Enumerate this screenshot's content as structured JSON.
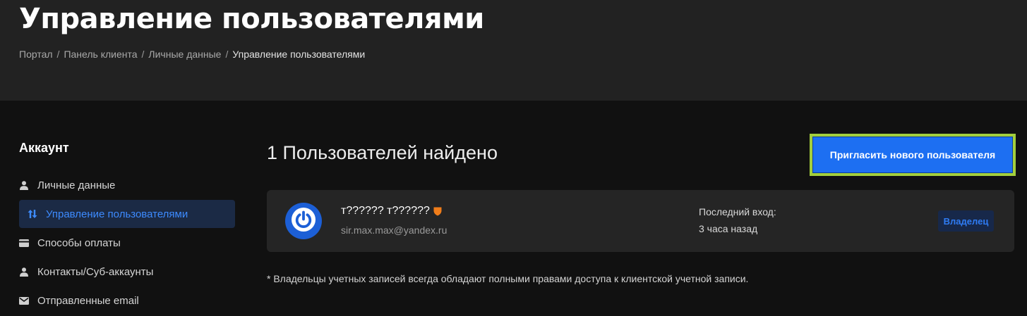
{
  "header": {
    "title": "Управление пользователями",
    "breadcrumb": [
      "Портал",
      "Панель клиента",
      "Личные данные",
      "Управление пользователями"
    ]
  },
  "sidebar": {
    "heading": "Аккаунт",
    "items": [
      {
        "label": "Личные данные",
        "icon": "person-icon",
        "active": false
      },
      {
        "label": "Управление пользователями",
        "icon": "sort-arrows-icon",
        "active": true
      },
      {
        "label": "Способы оплаты",
        "icon": "card-icon",
        "active": false
      },
      {
        "label": "Контакты/Суб-аккаунты",
        "icon": "person-icon",
        "active": false
      },
      {
        "label": "Отправленные email",
        "icon": "envelope-icon",
        "active": false
      }
    ]
  },
  "main": {
    "count_title": "1 Пользователей найдено",
    "invite_label": "Пригласить нового пользователя",
    "users": [
      {
        "name": "т?????? т??????",
        "email": "sir.max.max@yandex.ru",
        "last_login_label": "Последний вход:",
        "last_login_value": "3 часа назад",
        "role": "Владелец",
        "avatar_icon": "power-icon",
        "badge_icon": "shield-icon"
      }
    ],
    "footnote": "* Владельцы учетных записей всегда обладают полными правами доступа к клиентской учетной записи."
  },
  "colors": {
    "accent": "#1d6ff2",
    "highlight_border": "#a3cf3c",
    "shield": "#f07d1a",
    "active_bg": "#1b2a45",
    "active_text": "#3d8bff"
  }
}
